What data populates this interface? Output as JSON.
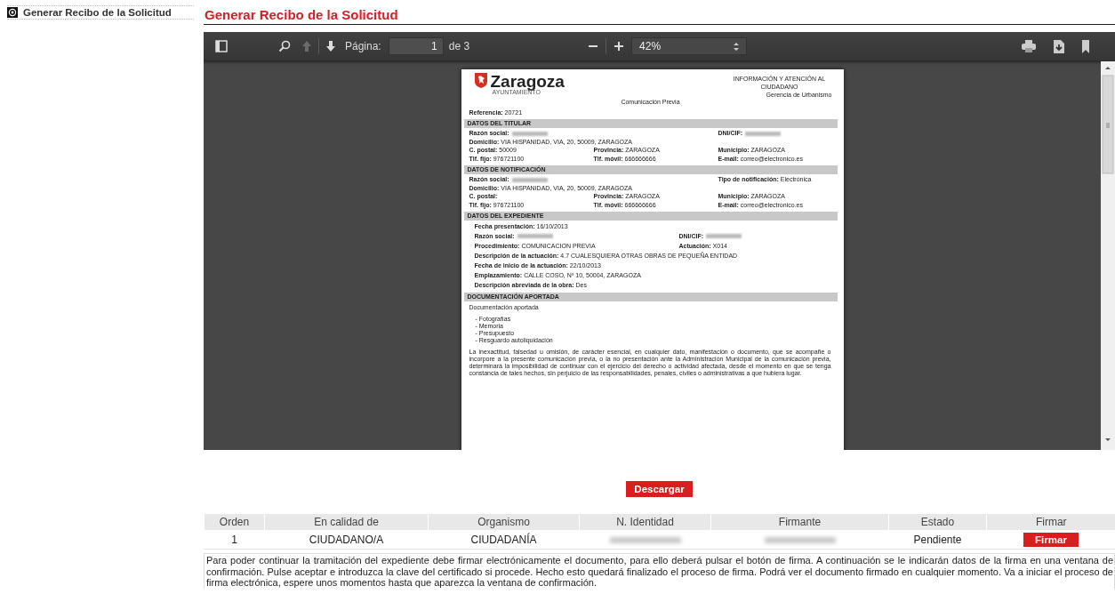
{
  "sidebar": {
    "items": [
      {
        "label": "Generar Recibo de la Solicitud",
        "selected": true
      }
    ]
  },
  "title": "Generar Recibo de la Solicitud",
  "viewer": {
    "toolbar": {
      "previous_page": {
        "disabled": true
      },
      "next_page": {
        "disabled": false
      },
      "page_label": "Página:",
      "page_value": "1",
      "page_total": "de 3",
      "zoom": "42%"
    },
    "document": {
      "logo_name": "Zaragoza",
      "logo_sub": "AYUNTAMIENTO",
      "org_lines": [
        "INFORMACIÓN Y ATENCIÓN AL",
        "CIUDADANO",
        "Gerencia de Urbanismo"
      ],
      "subtitle": "Comunicación Previa",
      "reference": {
        "label": "Referencia:",
        "value": "20721"
      },
      "sections": [
        {
          "heading": "DATOS DEL TITULAR",
          "kind": "grid",
          "rows": [
            {
              "left": {
                "label": "Razón social:",
                "redacted": true
              },
              "right": {
                "label": "DNI/CIF:",
                "redacted": true
              }
            },
            {
              "left": {
                "label": "Domicilio:",
                "value": "VIA HISPANIDAD, VIA,  20, 50009, ZARAGOZA"
              }
            },
            {
              "left": {
                "label": "C. postal:",
                "value": "50009"
              },
              "middle": {
                "label": "Provincia:",
                "value": "ZARAGOZA"
              },
              "right": {
                "label": "Municipio:",
                "value": "ZARAGOZA"
              }
            },
            {
              "left": {
                "label": "Tlf. fijo:",
                "value": "976721100"
              },
              "middle": {
                "label": "Tlf. móvil:",
                "value": "666666666"
              },
              "right": {
                "label": "E-mail:",
                "value": "correo@electronico.es"
              }
            }
          ]
        },
        {
          "heading": "DATOS DE NOTIFICACIÓN",
          "kind": "grid",
          "rows": [
            {
              "left": {
                "label": "Razón social:",
                "redacted": true
              },
              "right": {
                "label": "Tipo de notificación:",
                "value": "Electrónica"
              }
            },
            {
              "left": {
                "label": "Domicilio:",
                "value": "VIA HISPANIDAD, VIA,  20, 50009, ZARAGOZA"
              }
            },
            {
              "left": {
                "label": "C. postal:"
              },
              "middle": {
                "label": "Provincia:",
                "value": "ZARAGOZA"
              },
              "right": {
                "label": "Municipio:",
                "value": "ZARAGOZA"
              }
            },
            {
              "left": {
                "label": "Tlf. fijo:",
                "value": "976721100"
              },
              "middle": {
                "label": "Tlf. móvil:",
                "value": "666666666"
              },
              "right": {
                "label": "E-mail:",
                "value": "correo@electronico.es"
              }
            }
          ]
        },
        {
          "heading": "DATOS DEL EXPEDIENTE",
          "kind": "list",
          "rows": [
            {
              "left": {
                "label": "Fecha presentación:",
                "value": "16/10/2013"
              }
            },
            {
              "left": {
                "label": "Razón social:",
                "redacted": true
              },
              "right": {
                "label": "DNI/CIF:",
                "redacted": true
              }
            },
            {
              "left": {
                "label": "Procedimiento:",
                "value": "COMUNICACION PREVIA"
              },
              "right": {
                "label": "Actuación:",
                "value": "X014"
              }
            },
            {
              "left": {
                "label": "Descripción de la actuación:",
                "value": "4.7 CUALESQUIERA OTRAS OBRAS DE PEQUEÑA ENTIDAD"
              }
            },
            {
              "left": {
                "label": "Fecha de inicio de la actuación:",
                "value": "22/10/2013"
              }
            },
            {
              "left": {
                "label": "Emplazamiento:",
                "value": "CALLE COSO, Nº 10, 50004,  ZARAGOZA"
              }
            },
            {
              "left": {
                "label": "Descripción abreviada de la obra:",
                "value": "Des"
              }
            }
          ]
        },
        {
          "heading": "DOCUMENTACIÓN APORTADA",
          "kind": "docs",
          "intro": "Documentación aportada",
          "items": [
            "- Fotografías",
            "- Memoria",
            "- Presupuesto",
            "- Resguardo autoliquidación"
          ],
          "note": "La inexactitud, falsedad u omisión, de carácter esencial, en cualquier dato, manifestación o documento, que se acompañe o incorpore a la presente comunicación previa, o la no presentación ante la Administración Municipal de la comunicación previa, determinará la imposibilidad de continuar con el ejercicio del derecho o actividad afectada, desde el momento en que se tenga constancia de tales hechos, sin perjuicio de las responsabilidades, penales, civiles o administrativas a que hubiera lugar."
        }
      ]
    }
  },
  "download_button": "Descargar",
  "table": {
    "columns": [
      "Orden",
      "En calidad de",
      "Organismo",
      "N. Identidad",
      "Firmante",
      "Estado",
      "Firmar"
    ],
    "rows": [
      {
        "orden": "1",
        "calidad": "CIUDADANO/A",
        "organismo": "CIUDADANÍA",
        "identidad": {
          "redacted": true
        },
        "firmante": {
          "redacted": true
        },
        "estado": "Pendiente",
        "action": "Firmar"
      }
    ]
  },
  "instructions": "Para poder continuar la tramitación del expediente debe firmar electrónicamente el documento, para ello deberá pulsar el botón de firma. A continuación se le indicarán datos de la firma en una ventana de confirmación. Pulse aceptar e introduzca la clave del certificado si procede. Hecho esto quedará finalizado el proceso de firma. Podrá ver el documento firmado en cualquier momento. Va a iniciar el proceso de firma electrónica, espere unos momentos hasta que aparezca la ventana de confirmación."
}
